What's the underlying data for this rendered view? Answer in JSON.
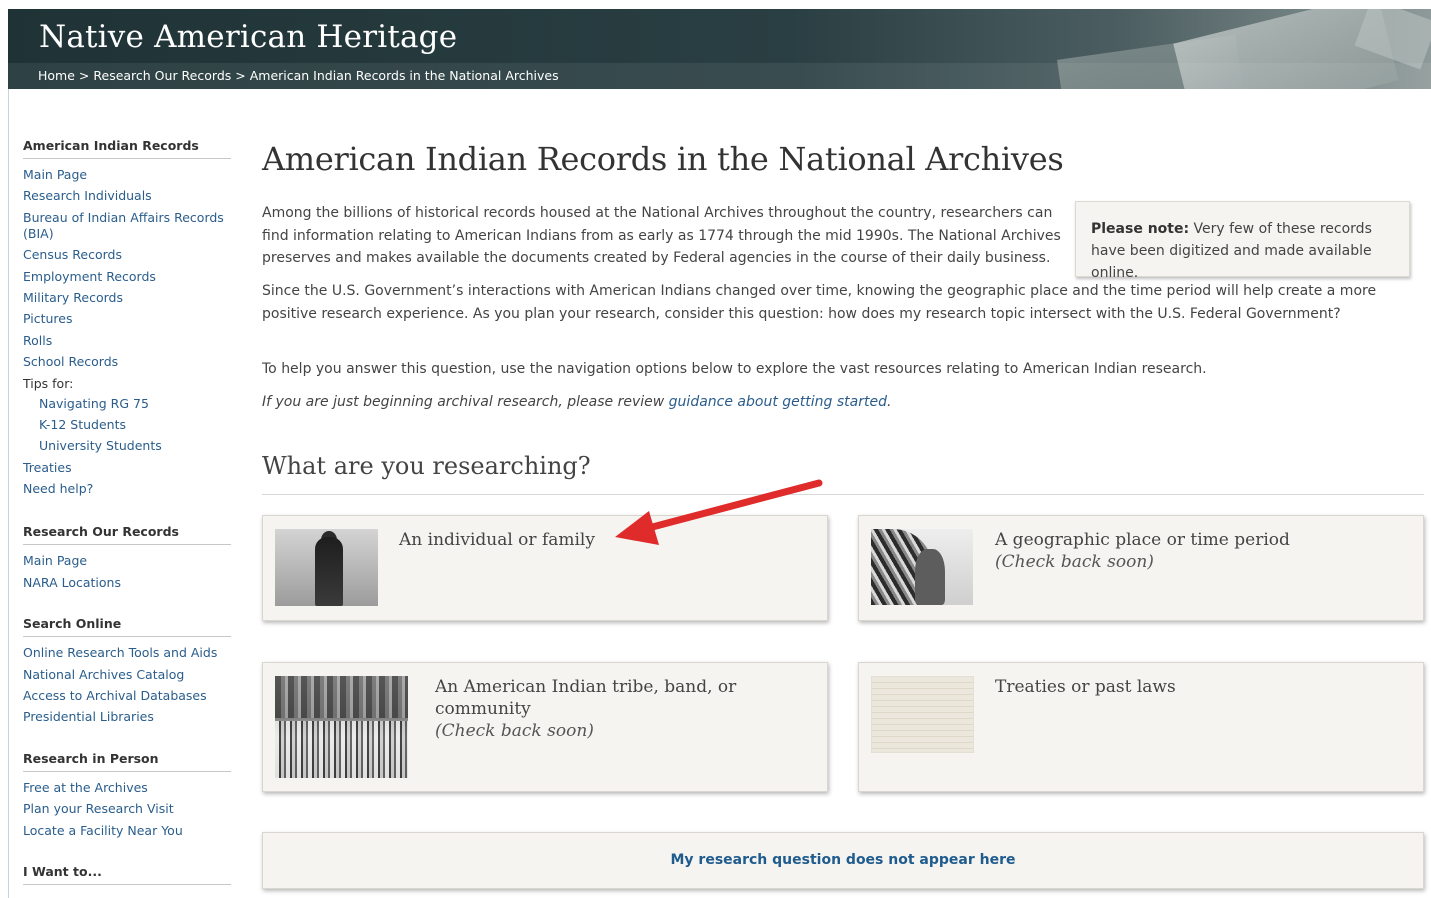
{
  "header": {
    "site_title": "Native American Heritage",
    "breadcrumb": [
      "Home",
      "Research Our Records",
      "American Indian Records in the National Archives"
    ],
    "breadcrumb_sep": ">"
  },
  "sidebar": {
    "sections": [
      {
        "title": "American Indian Records",
        "items": [
          "Main Page",
          "Research Individuals",
          "Bureau of Indian Affairs Records (BIA)",
          "Census Records",
          "Employment Records",
          "Military Records",
          "Pictures",
          "Rolls",
          "School Records"
        ],
        "tips_label": "Tips for:",
        "tips": [
          "Navigating RG 75",
          "K-12 Students",
          "University Students"
        ],
        "after": [
          "Treaties",
          "Need help?"
        ]
      },
      {
        "title": "Research Our Records",
        "items": [
          "Main Page",
          "NARA Locations"
        ]
      },
      {
        "title": "Search Online",
        "items": [
          "Online Research Tools and Aids",
          "National Archives Catalog",
          "Access to Archival Databases",
          "Presidential Libraries"
        ]
      },
      {
        "title": "Research in Person",
        "items": [
          "Free at the Archives",
          "Plan your Research Visit",
          "Locate a Facility Near You"
        ]
      },
      {
        "title": "I Want to..."
      }
    ]
  },
  "main": {
    "title": "American Indian Records in the National Archives",
    "note": {
      "label": "Please note:",
      "text": " Very few of these records have been digitized and made available online."
    },
    "paragraphs": [
      "Among the billions of historical records housed at the National Archives throughout the country, researchers can find information relating to American Indians from as early as 1774 through the mid 1990s. The National Archives preserves and makes available the documents created by Federal agencies in the course of their daily business.",
      "Since the U.S. Government’s interactions with American Indians changed over time, knowing the geographic place and the time period will help create a more positive research experience. As you plan your research, consider this question: how does my research topic intersect with the U.S. Federal Government?",
      "To help you answer this question, use the navigation options below to explore the vast resources relating to American Indian research."
    ],
    "beginner": {
      "prefix": "If you are just beginning archival research, please review ",
      "link": "guidance about getting started",
      "suffix": "."
    },
    "question_heading": "What are you researching?",
    "cards": [
      {
        "title": "An individual or family",
        "note": ""
      },
      {
        "title": "A geographic place or time period",
        "note": "(Check back soon)"
      },
      {
        "title": "An American Indian tribe, band, or community",
        "note": "(Check back soon)"
      },
      {
        "title": "Treaties or past laws",
        "note": ""
      }
    ],
    "fallback_button": "My research question does not appear here"
  },
  "colors": {
    "header_bg": "#263a3d",
    "link": "#2a5d8c",
    "card_bg": "#f5f4f1",
    "annotation_arrow": "#e02b2b"
  }
}
